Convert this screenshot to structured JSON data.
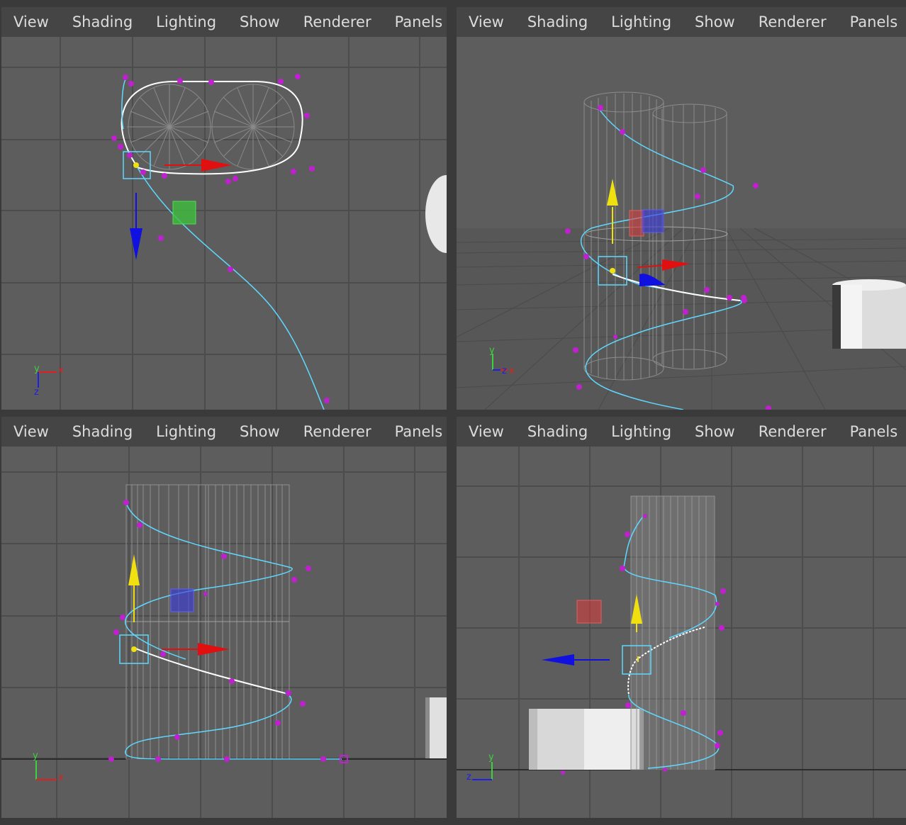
{
  "menus": [
    "View",
    "Shading",
    "Lighting",
    "Show",
    "Renderer",
    "Panels"
  ],
  "panels": [
    {
      "id": "top-left",
      "name": "top-view-panel",
      "axes": [
        "y",
        "x",
        "z"
      ]
    },
    {
      "id": "top-right",
      "name": "perspective-view-panel",
      "axes": [
        "y",
        "z",
        "x"
      ]
    },
    {
      "id": "bottom-left",
      "name": "front-view-panel",
      "axes": [
        "y",
        "x"
      ]
    },
    {
      "id": "bottom-right",
      "name": "side-view-panel",
      "axes": [
        "y",
        "z"
      ]
    }
  ],
  "colors": {
    "background": "#5d5d5d",
    "menubar": "#454545",
    "menu_text": "#dcdcdc",
    "grid": "#4a4a4a",
    "curve": "#5fd8ff",
    "curve_selected": "#ffffff",
    "cv_point": "#c020d0",
    "manip_x": "#e01010",
    "manip_y": "#f0e010",
    "manip_z": "#1010e0",
    "wireframe": "#9a9a9a"
  }
}
